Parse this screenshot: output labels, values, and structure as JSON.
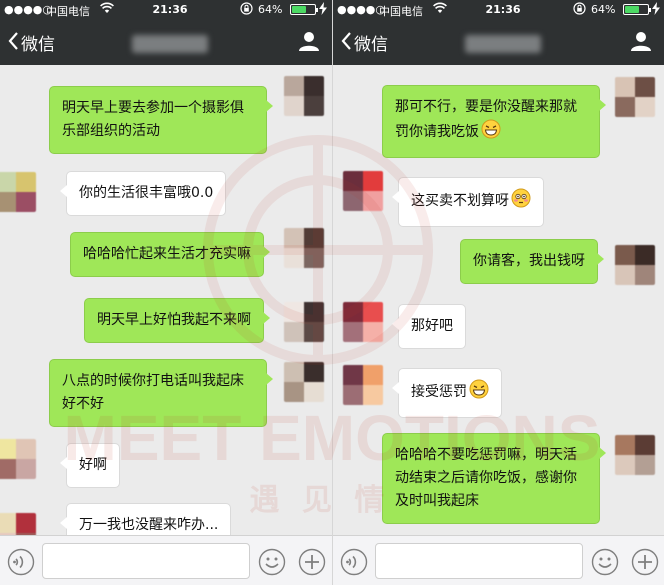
{
  "status_bar": {
    "signal": "●●●●○",
    "carrier": "中国电信",
    "time": "21:36",
    "battery_percent": "64%",
    "battery_level": 0.64
  },
  "nav": {
    "back_label": "微信"
  },
  "watermark": {
    "text": "MEET EMOTIONS",
    "subtext": "遇 见 情"
  },
  "left_chat": {
    "messages": [
      {
        "from": "me",
        "text": "明天早上要去参加一个摄影俱乐部组织的活动"
      },
      {
        "from": "them",
        "text": "你的生活很丰富哦0.0"
      },
      {
        "from": "me",
        "text": "哈哈哈忙起来生活才充实嘛"
      },
      {
        "from": "me",
        "text": "明天早上好怕我起不来啊"
      },
      {
        "from": "me",
        "text": "八点的时候你打电话叫我起床好不好"
      },
      {
        "from": "them",
        "text": "好啊"
      },
      {
        "from": "them",
        "text": "万一我也没醒来咋办..."
      }
    ]
  },
  "right_chat": {
    "messages": [
      {
        "from": "me",
        "text": "那可不行，要是你没醒来那就罚你请我吃饭",
        "emoji": "grin-emoji"
      },
      {
        "from": "them",
        "text": "这买卖不划算呀",
        "emoji": "flushed-emoji"
      },
      {
        "from": "me",
        "text": "你请客，我出钱呀"
      },
      {
        "from": "them",
        "text": "那好吧"
      },
      {
        "from": "them",
        "text": "接受惩罚",
        "emoji": "grin-emoji"
      },
      {
        "from": "me",
        "text": "哈哈哈不要吃惩罚嘛，明天活动结束之后请你吃饭，感谢你及时叫我起床"
      }
    ]
  },
  "colors": {
    "nav_bg": "#2e3132",
    "chat_bg": "#ebebeb",
    "my_bubble": "#9fe758",
    "their_bubble": "#ffffff",
    "battery": "#4cd964"
  }
}
